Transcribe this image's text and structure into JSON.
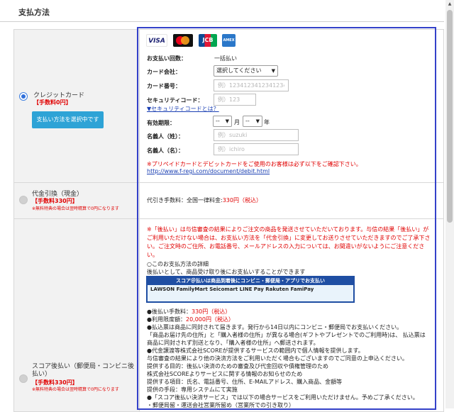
{
  "header": {
    "title": "支払方法"
  },
  "options": [
    {
      "name": "クレジットカード",
      "fee": "【手数料0円】",
      "selected": true,
      "button": "支払い方法を選択中です"
    },
    {
      "name": "代金引換（現金）",
      "fee": "【手数料330円】",
      "note": "※無料特典の場合は翌時精算で0円になります"
    },
    {
      "name": "スコア後払い（郵便局・コンビニ後払い）",
      "fee": "【手数料330円】",
      "note": "※無料特典の場合は翌時精算で0円になります"
    }
  ],
  "card_logos": [
    "VISA",
    "Mastercard",
    "JCB",
    "AMERICAN EXPRESS"
  ],
  "credit": {
    "count_label": "お支払い回数：",
    "count_value": "一括払い",
    "company_label": "カード会社：",
    "company_select": "選択してください",
    "number_label": "カード番号：",
    "number_placeholder": "例）1234123412341234",
    "security_label": "セキュリティコード：",
    "security_placeholder": "例）123",
    "security_link": "▼セキュリティコードとは？",
    "expiry_label": "有効期限：",
    "expiry_month": "--",
    "month_unit": "月",
    "expiry_year": "--",
    "year_unit": "年",
    "last_label": "名義人（姓）：",
    "last_placeholder": "例）suzuki",
    "first_label": "名義人（名）：",
    "first_placeholder": "例）ichiro",
    "prepaid_note": "※プリペイドカードとデビットカードをご使用のお客様は必ず以下をご確認下さい。",
    "debit_link": "http://www.f-regi.com/document/debit.html"
  },
  "cod": {
    "fee_prefix": "代引き手数料：全国一律料金:",
    "fee_value": "330円（税込）"
  },
  "atobarai": {
    "warning": "※「後払い」は与信審査の結果によりご注文の商品を発送させていただいております。与信の結果「後払い」がご利用いただけない場合は、お支払い方法を「代金引換」に変更してお送りさせていただきますのでご了承下さい。ご注文時のご住所、お電話番号、メールアドレスの入力については、お間違いがないようにご注意ください。",
    "detail_title": "○このお支払方法の詳細",
    "detail_desc": "後払いとして、商品受け取り後にお支払いすることができます",
    "banner_title": "スコア＠払いは商品到着後にコンビニ・郵便局・アプリでお支払い",
    "banner_logos": "LAWSON  FamilyMart  Seicomart  LINE Pay  Rakuten  FamiPay",
    "fee_label": "●後払い手数料：",
    "fee_value": "330円（税込）",
    "limit_label": "●利用限度額：",
    "limit_value": "20,000円（税込）",
    "lines": [
      "●払込票は商品に同封されて届きます。発行から14日以内にコンビニ・郵便局でお支払いください。",
      "「商品お届け先の住所」と「購入者様の住所」が異なる場合(ギフトやプレゼントでのご利用時)は、 払込票は",
      "商品に同封されず別送となり、「購入者様の住所」へ郵送されます。",
      "●代金譲渡等株式会社SCOREが提供するサービスの範囲内で個人情報を提供します。",
      "与信審査の結果により他の決済方法をご利用いただく場合もございますのでご同意の上申込ください。",
      "提供する目的：後払い決済のための審査及び代金回収や債権管理のため",
      "株式会社SCOREよりサービスに関する情報のお知らせのため",
      "提供する項目：氏名、電話番号、住所、E-MAILアドレス、購入商品、金額等",
      "提供の手段：専用システムにて実施",
      "●「スコア後払い決済サービス」では以下の場合サービスをご利用いただけません。予めご了承ください。",
      "・郵便局留・運送会社営業所留め（営業所での引き取り）"
    ]
  }
}
